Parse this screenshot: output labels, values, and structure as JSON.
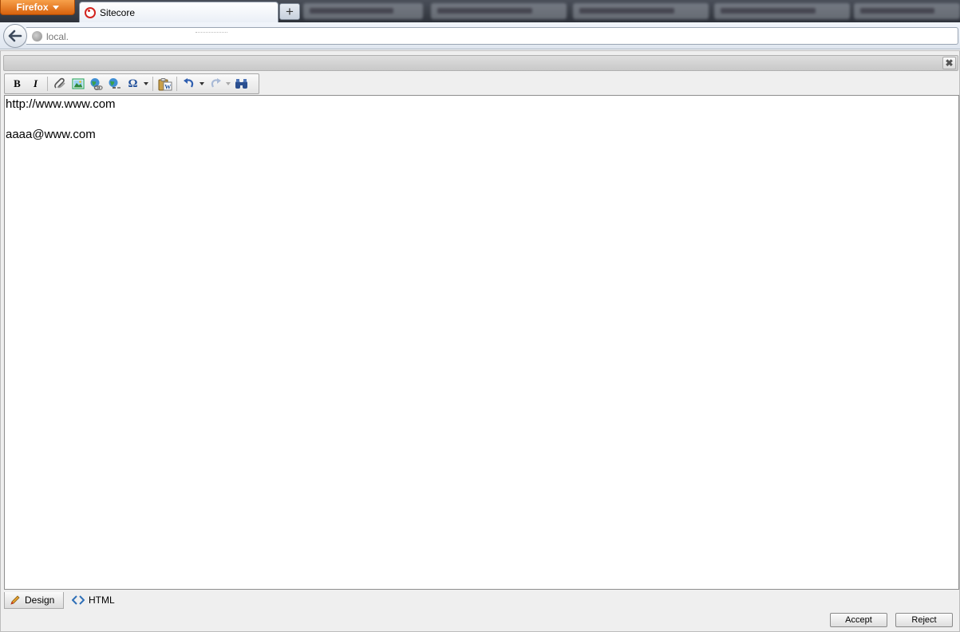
{
  "browser": {
    "app_button_label": "Firefox",
    "active_tab_title": "Sitecore",
    "new_tab_label": "+",
    "url_text": "local.",
    "colors": {
      "app_button": "#e8731a",
      "chrome_dark": "#3a3f48",
      "favicon": "#d2231e"
    }
  },
  "toolbar": {
    "buttons": [
      {
        "name": "bold",
        "label": "B"
      },
      {
        "name": "italic",
        "label": "I"
      },
      {
        "name": "insert-link",
        "icon": "link-icon"
      },
      {
        "name": "insert-image",
        "icon": "image-icon"
      },
      {
        "name": "insert-hyperlink",
        "icon": "globe-link-icon"
      },
      {
        "name": "remove-link",
        "icon": "globe-unlink-icon"
      },
      {
        "name": "special-characters",
        "label": "Ω"
      },
      {
        "name": "paste-from-word",
        "icon": "paste-word-icon"
      },
      {
        "name": "undo",
        "icon": "undo-icon"
      },
      {
        "name": "redo",
        "icon": "redo-icon"
      },
      {
        "name": "find-replace",
        "icon": "binoculars-icon"
      }
    ]
  },
  "editor": {
    "lines": [
      "http://www.www.com",
      "aaaa@www.com"
    ]
  },
  "modes": {
    "design_label": "Design",
    "html_label": "HTML"
  },
  "actions": {
    "accept_label": "Accept",
    "reject_label": "Reject"
  }
}
